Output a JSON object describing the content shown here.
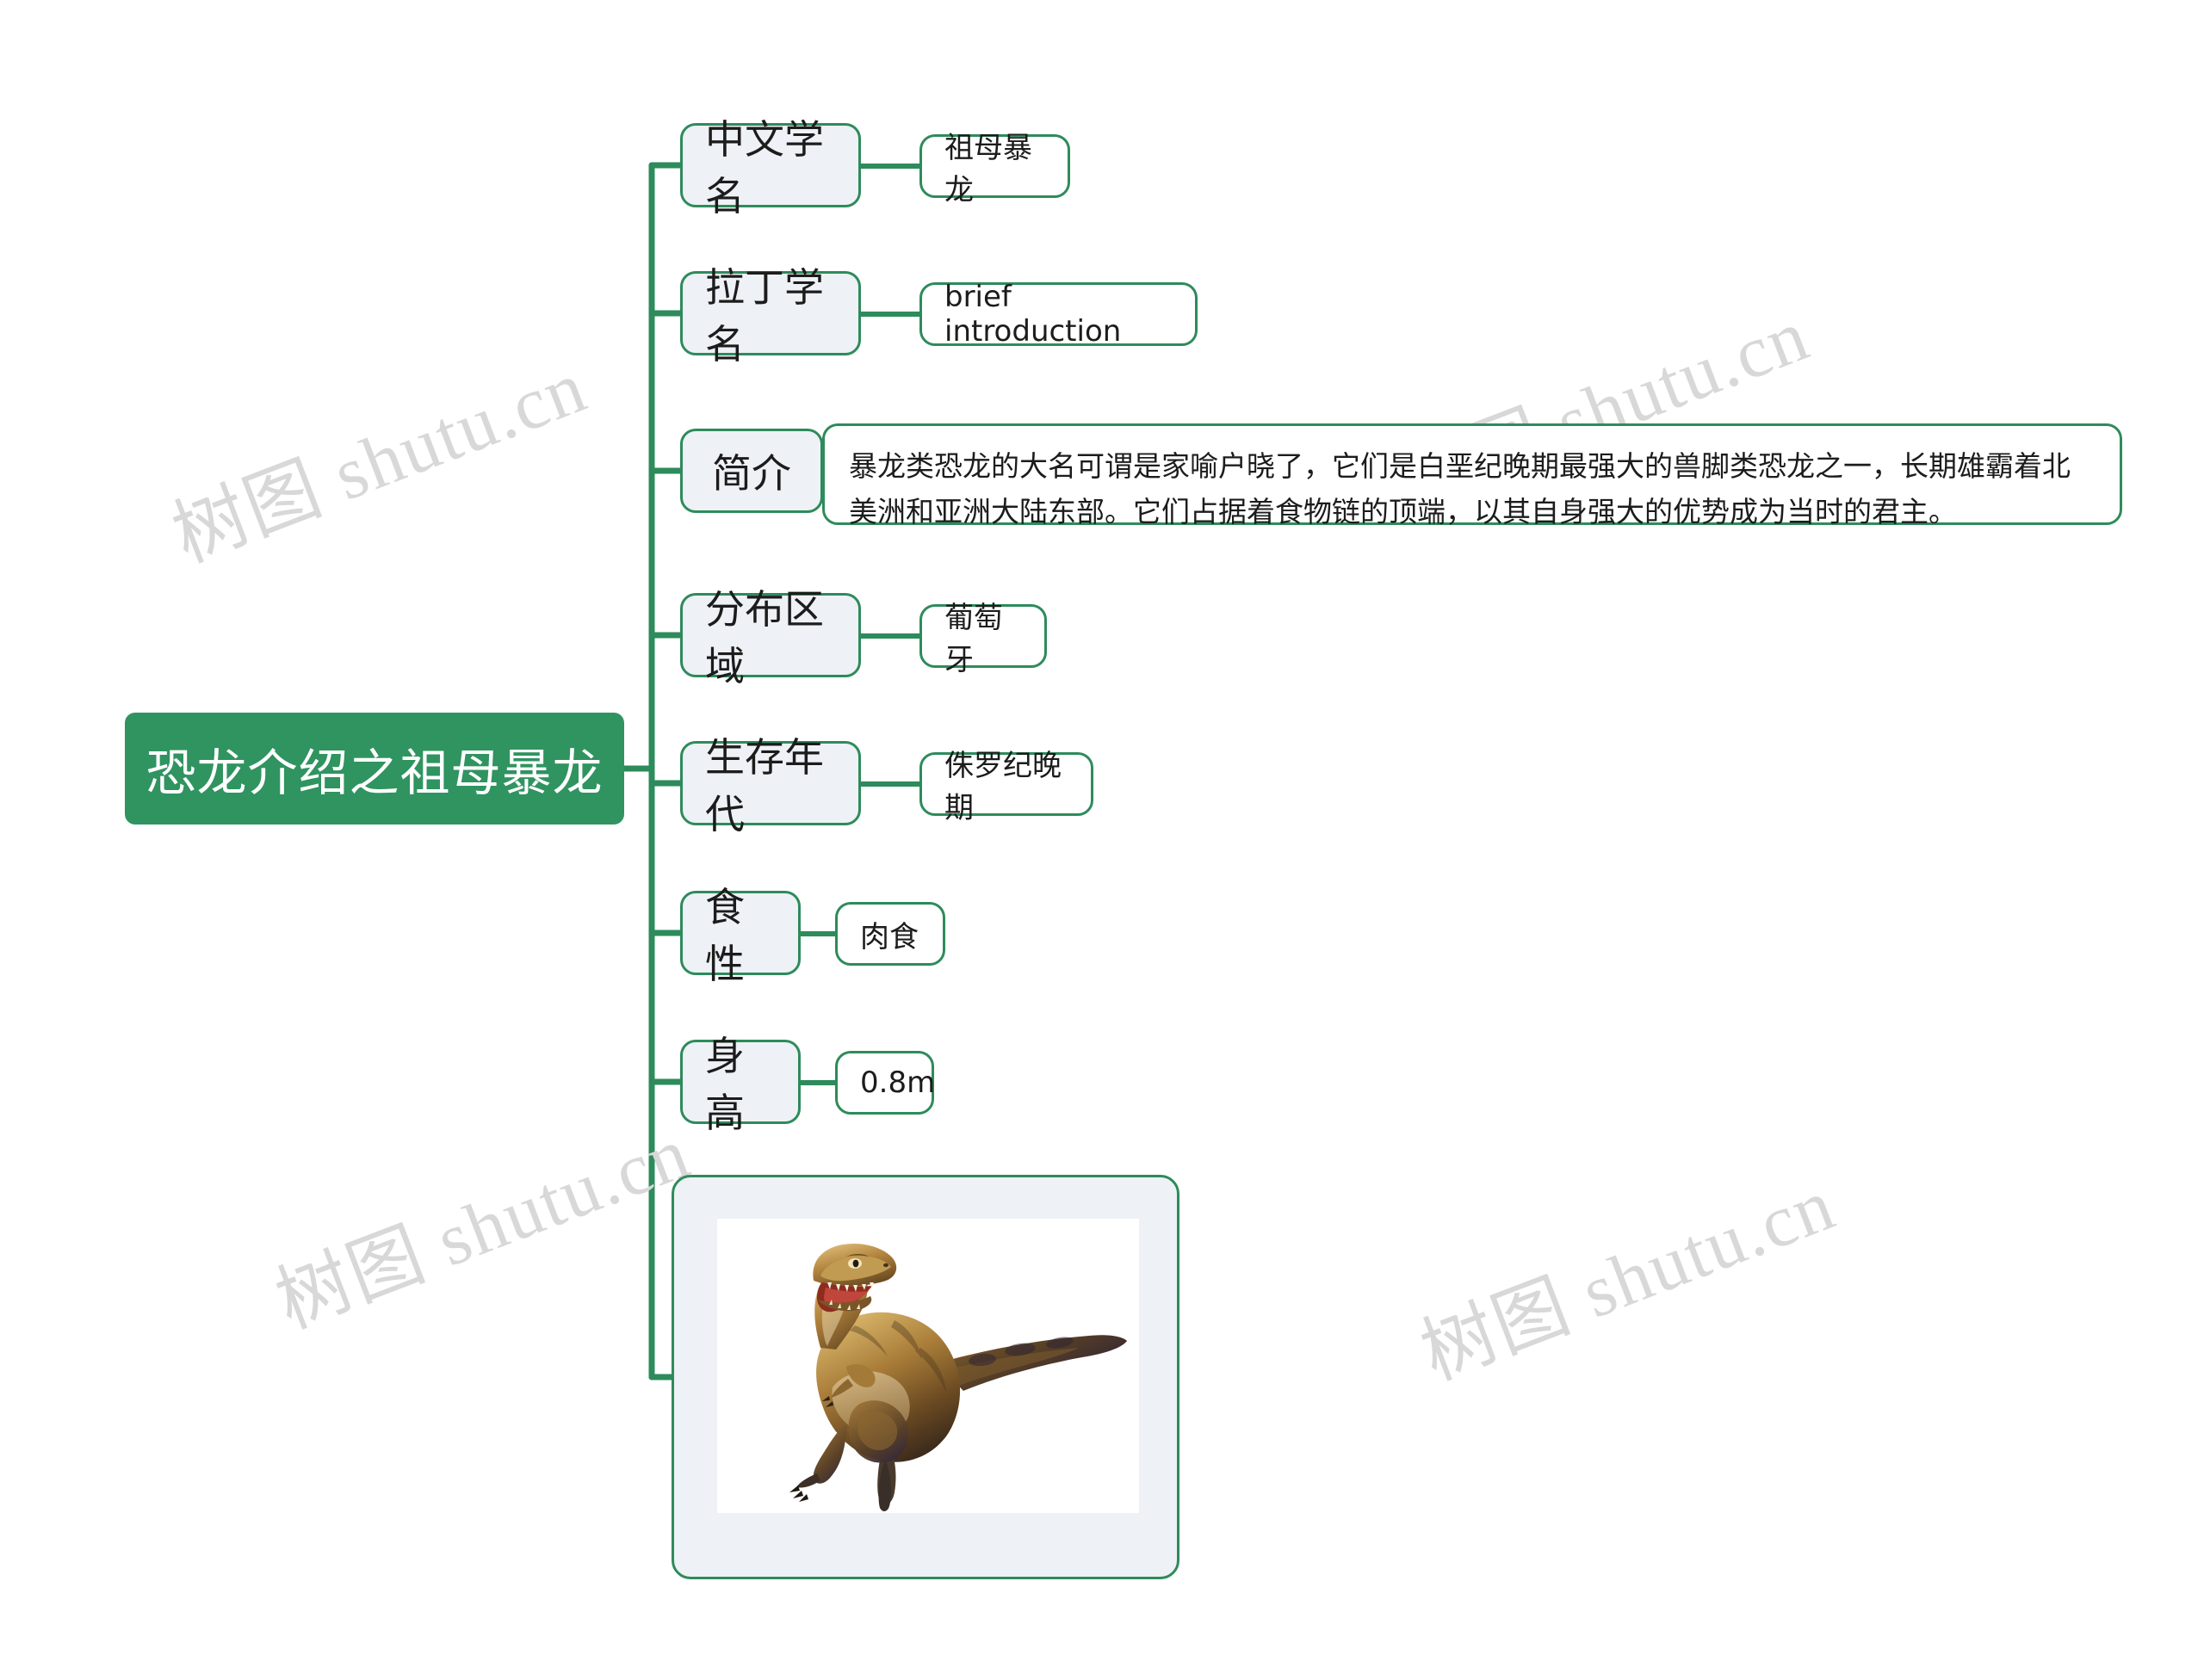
{
  "document": {
    "type": "mind-map",
    "background_color": "#ffffff",
    "accent_color": "#2e8b5b",
    "root_fill": "#2f9460",
    "branch_fill": "#eef1f5",
    "leaf_fill": "#ffffff"
  },
  "watermark": {
    "text_cjk": "树图",
    "text_latin": "shutu.cn",
    "full": "树图 shutu.cn",
    "color": "#d8d8d8"
  },
  "root": {
    "label": "恐龙介绍之祖母暴龙"
  },
  "branches": [
    {
      "key": "chinese_name",
      "label": "中文学名",
      "value": "祖母暴龙",
      "value_kind": "text"
    },
    {
      "key": "latin_name",
      "label": "拉丁学名",
      "value": "brief introduction",
      "value_kind": "text"
    },
    {
      "key": "introduction",
      "label": "简介",
      "value": "暴龙类恐龙的大名可谓是家喻户晓了，它们是白垩纪晚期最强大的兽脚类恐龙之一，长期雄霸着北美洲和亚洲大陆东部。它们占据着食物链的顶端，以其自身强大的优势成为当时的君主。",
      "value_kind": "paragraph"
    },
    {
      "key": "distribution",
      "label": "分布区域",
      "value": "葡萄牙",
      "value_kind": "text"
    },
    {
      "key": "period",
      "label": "生存年代",
      "value": "侏罗纪晚期",
      "value_kind": "text"
    },
    {
      "key": "diet",
      "label": "食性",
      "value": "肉食",
      "value_kind": "text"
    },
    {
      "key": "height",
      "label": "身高",
      "value": "0.8m",
      "value_kind": "text"
    },
    {
      "key": "illustration",
      "label": "",
      "value": "",
      "value_kind": "image",
      "image_alt": "tyrannosaurus-illustration"
    }
  ]
}
